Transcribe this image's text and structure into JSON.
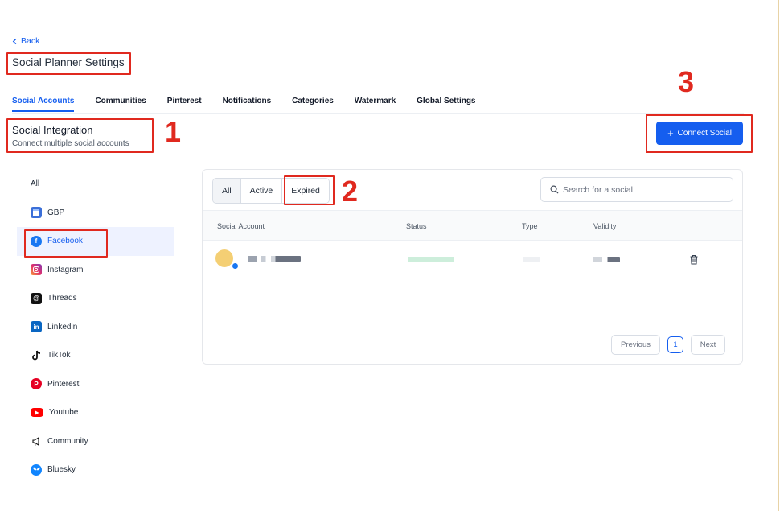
{
  "header": {
    "back_label": "Back",
    "page_title": "Social Planner Settings"
  },
  "tabs": [
    {
      "label": "Social Accounts",
      "active": true
    },
    {
      "label": "Communities"
    },
    {
      "label": "Pinterest"
    },
    {
      "label": "Notifications"
    },
    {
      "label": "Categories"
    },
    {
      "label": "Watermark"
    },
    {
      "label": "Global Settings"
    }
  ],
  "section": {
    "title": "Social Integration",
    "subtitle": "Connect multiple social accounts",
    "connect_label": "Connect Social"
  },
  "sidebar": {
    "items": [
      {
        "label": "All",
        "icon": "none"
      },
      {
        "label": "GBP",
        "icon": "gbp-icon"
      },
      {
        "label": "Facebook",
        "icon": "facebook-icon",
        "active": true
      },
      {
        "label": "Instagram",
        "icon": "instagram-icon"
      },
      {
        "label": "Threads",
        "icon": "threads-icon"
      },
      {
        "label": "Linkedin",
        "icon": "linkedin-icon"
      },
      {
        "label": "TikTok",
        "icon": "tiktok-icon"
      },
      {
        "label": "Pinterest",
        "icon": "pinterest-icon"
      },
      {
        "label": "Youtube",
        "icon": "youtube-icon"
      },
      {
        "label": "Community",
        "icon": "megaphone-icon"
      },
      {
        "label": "Bluesky",
        "icon": "bluesky-icon"
      }
    ]
  },
  "filters": {
    "options": [
      "All",
      "Active",
      "Expired"
    ],
    "selected": "All"
  },
  "search": {
    "placeholder": "Search for a social"
  },
  "table": {
    "columns": [
      "Social Account",
      "Status",
      "Type",
      "Validity"
    ]
  },
  "pagination": {
    "previous": "Previous",
    "page": "1",
    "next": "Next"
  },
  "annotations": [
    "1",
    "2",
    "3"
  ],
  "colors": {
    "accent": "#155eef",
    "highlight": "#e0291f"
  }
}
